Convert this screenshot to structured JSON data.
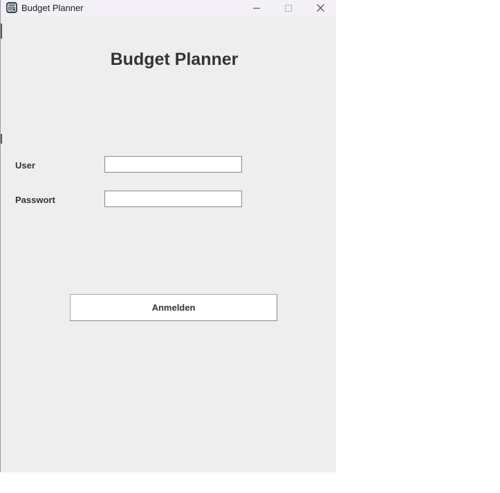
{
  "window": {
    "title": "Budget Planner",
    "icon": "budget-app-icon",
    "controls": {
      "minimize_icon": "minimize-icon",
      "maximize_icon": "maximize-icon",
      "close_icon": "close-icon"
    }
  },
  "form": {
    "heading": "Budget Planner",
    "user_label": "User",
    "user_value": "",
    "password_label": "Passwort",
    "password_value": "",
    "login_button": "Anmelden"
  },
  "colors": {
    "window_background": "#eeeeee",
    "titlebar_background": "#f3f0f7",
    "text": "#333333",
    "input_background": "#ffffff"
  }
}
